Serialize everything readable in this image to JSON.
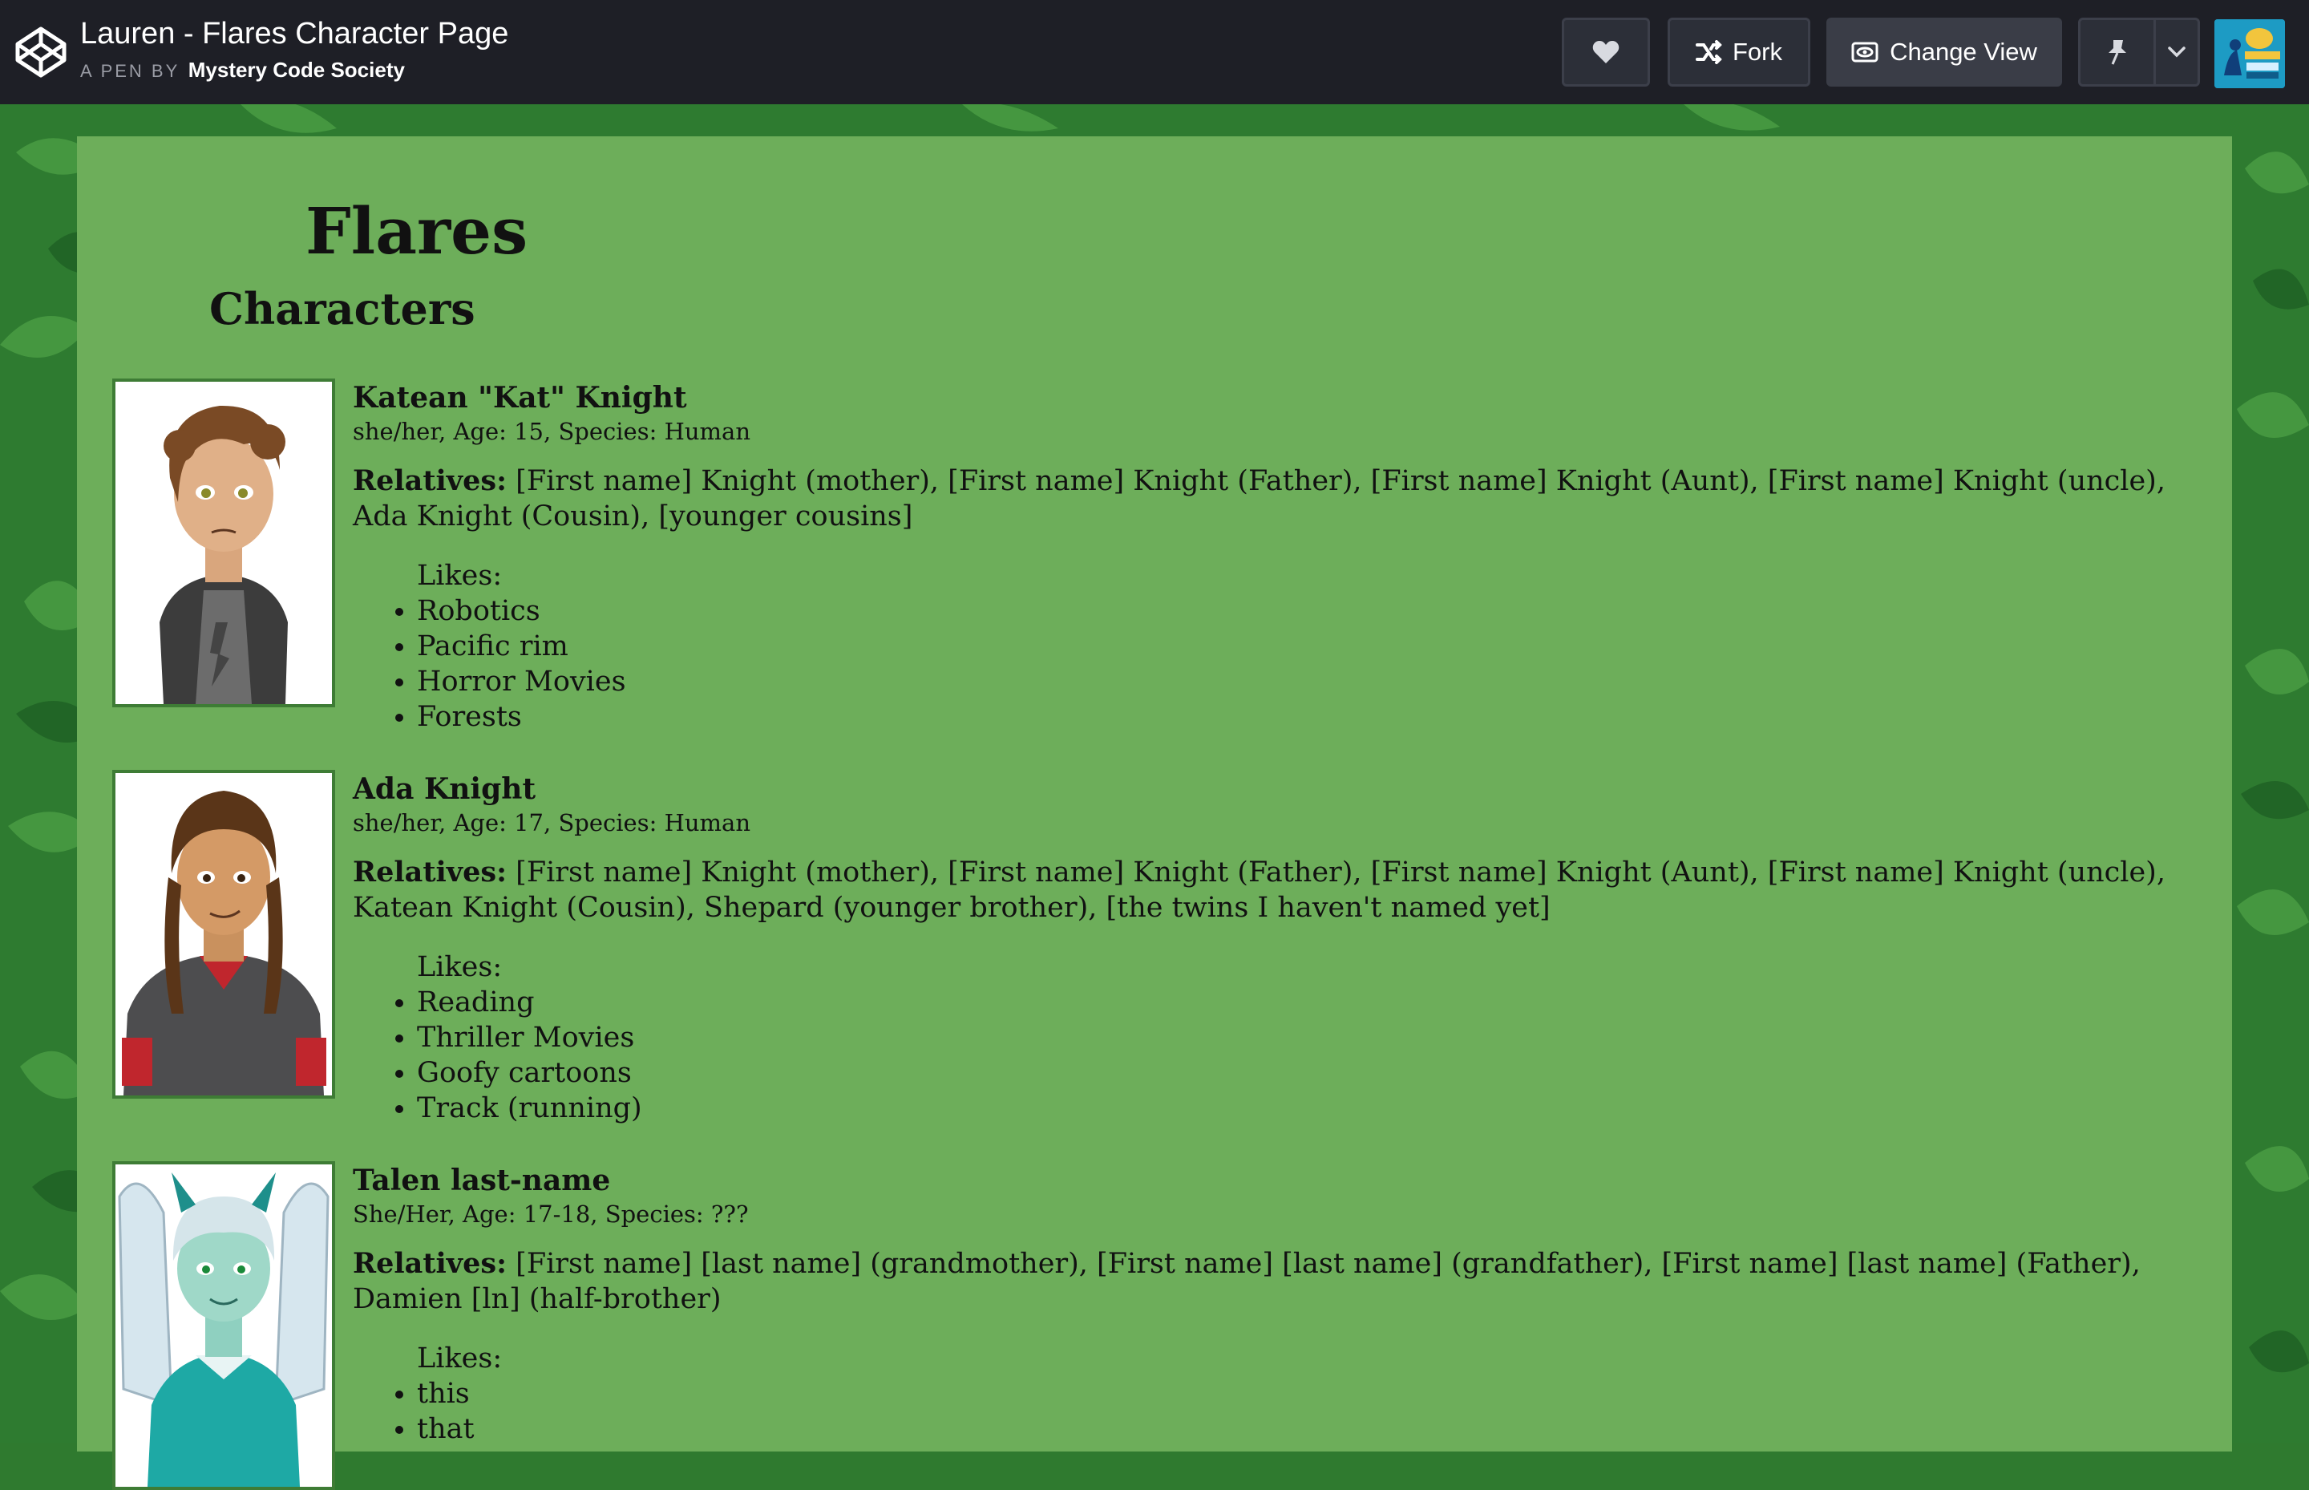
{
  "header": {
    "pen_title": "Lauren - Flares Character Page",
    "byline_prefix": "A PEN BY",
    "author": "Mystery Code Society",
    "fork_label": "Fork",
    "change_view_label": "Change View"
  },
  "page": {
    "title": "Flares",
    "section_title": "Characters",
    "relatives_label": "Relatives:",
    "likes_label": "Likes:"
  },
  "characters": [
    {
      "name": "Katean \"Kat\" Knight",
      "meta": "she/her, Age: 15, Species: Human",
      "relatives": "[First name] Knight (mother), [First name] Knight (Father), [First name] Knight (Aunt), [First name] Knight (uncle), Ada Knight (Cousin), [younger cousins]",
      "likes": [
        "Robotics",
        "Pacific rim",
        "Horror Movies",
        "Forests"
      ]
    },
    {
      "name": "Ada Knight",
      "meta": "she/her, Age: 17, Species: Human",
      "relatives": "[First name] Knight (mother), [First name] Knight (Father), [First name] Knight (Aunt), [First name] Knight (uncle), Katean Knight (Cousin), Shepard (younger brother), [the twins I haven't named yet]",
      "likes": [
        "Reading",
        "Thriller Movies",
        "Goofy cartoons",
        "Track (running)"
      ]
    },
    {
      "name": "Talen last-name",
      "meta": "She/Her, Age: 17-18, Species: ???",
      "relatives": "[First name] [last name] (grandmother), [First name] [last name] (grandfather), [First name] [last name] (Father), Damien [ln] (half-brother)",
      "likes": [
        "this",
        "that"
      ]
    }
  ],
  "colors": {
    "topbar": "#1e1f26",
    "panel": "#6dae5a",
    "border": "#3e7c35",
    "background": "#2f7a2f"
  },
  "icons": [
    "codepen-logo-icon",
    "heart-icon",
    "fork-icon",
    "eye-icon",
    "pin-icon",
    "chevron-down-icon"
  ]
}
